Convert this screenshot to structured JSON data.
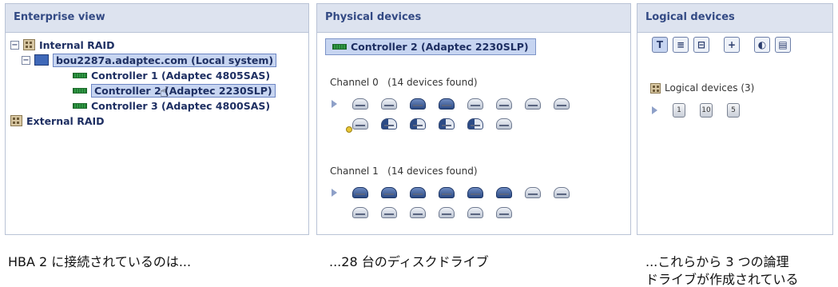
{
  "enterprise": {
    "title": "Enterprise view",
    "tree": [
      {
        "label": "Internal RAID",
        "expander": "−"
      },
      {
        "label": "bou2287a.adaptec.com (Local system)",
        "expander": "−"
      },
      {
        "label": "Controller 1 (Adaptec 4805SAS)"
      },
      {
        "label": "Controller 2 (Adaptec 2230SLP)"
      },
      {
        "label": "Controller 3 (Adaptec 4800SAS)"
      },
      {
        "label": "External RAID"
      }
    ]
  },
  "physical": {
    "title": "Physical devices",
    "selected": "Controller 2 (Adaptec 2230SLP)",
    "channels": [
      {
        "label": "Channel 0",
        "found": "(14 devices found)"
      },
      {
        "label": "Channel 1",
        "found": "(14 devices found)"
      }
    ]
  },
  "logical": {
    "title": "Logical devices",
    "toolbar": [
      "T",
      "≡",
      "⊟",
      "+",
      "◐",
      "▤"
    ],
    "summary": "Logical devices (3)",
    "devices": [
      "1",
      "10",
      "5"
    ]
  },
  "captions": {
    "left": "HBA 2 に接続されているのは...",
    "middle": "...28 台のディスクドライブ",
    "right_line1": "...これらから 3 つの論理",
    "right_line2": "ドライブが作成されている"
  },
  "colors": {
    "header_bg": "#dde3ef",
    "selection_bg": "#c7d5f1",
    "header_text": "#334a84"
  }
}
